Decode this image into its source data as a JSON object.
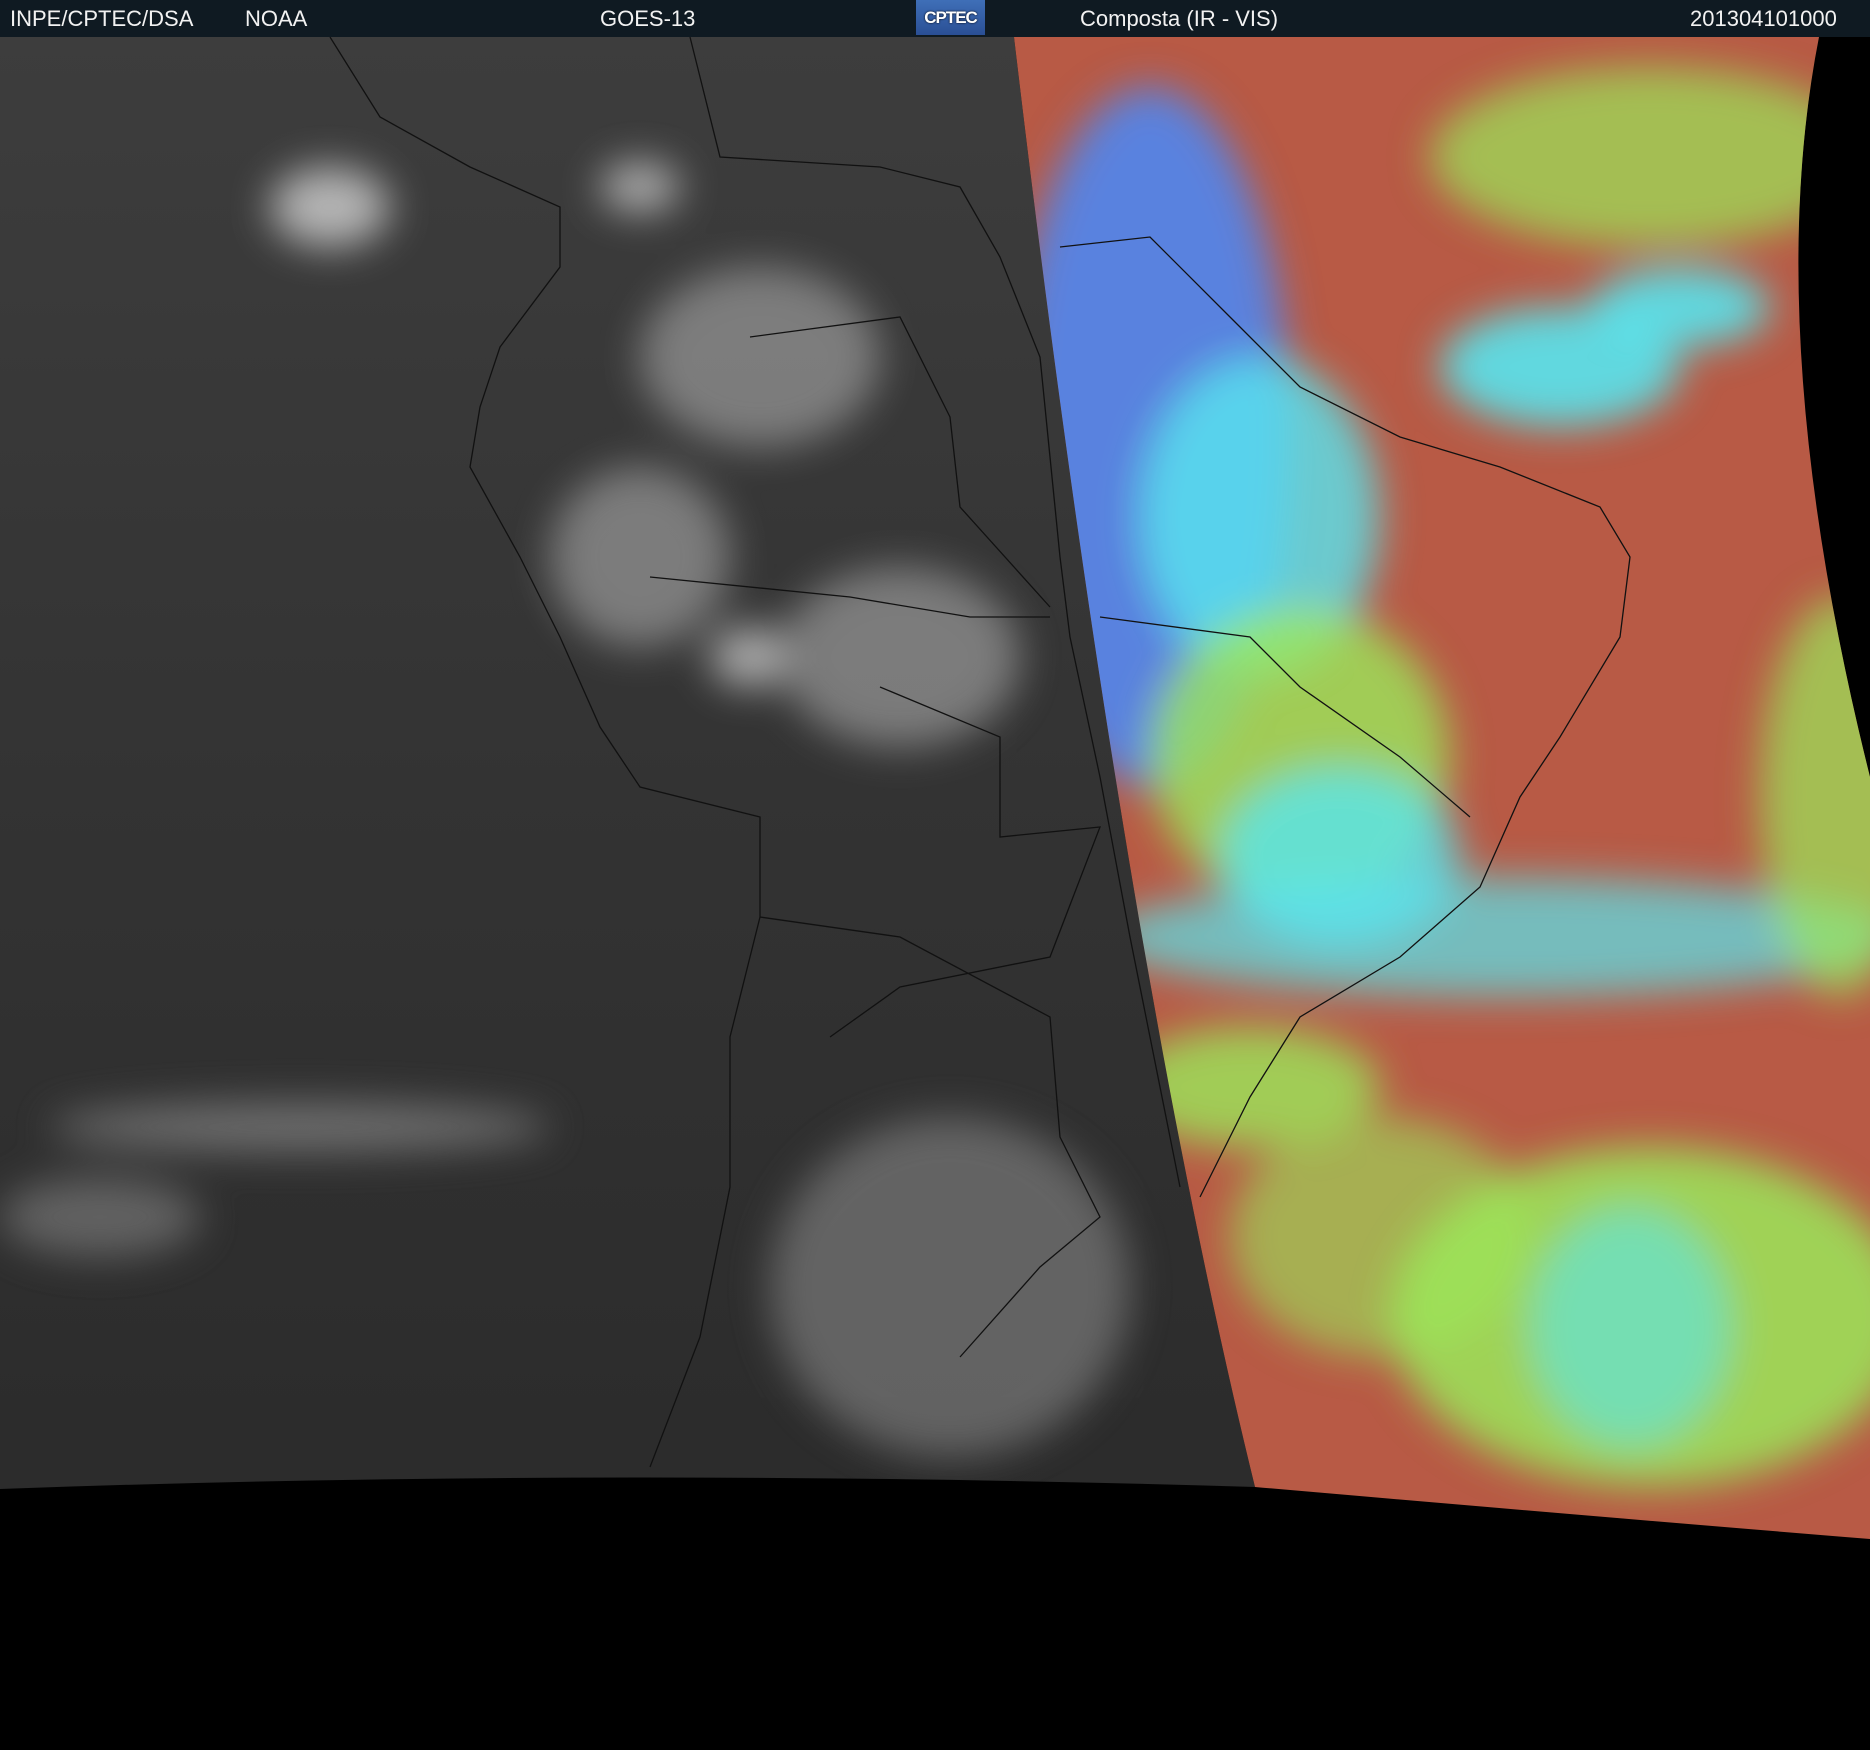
{
  "header": {
    "agency": "INPE/CPTEC/DSA",
    "partner": "NOAA",
    "satellite": "GOES-13",
    "logo_text": "CPTEC",
    "product": "Composta (IR - VIS)",
    "timestamp": "201304101000"
  },
  "colors": {
    "header_bg": "#0f1a22",
    "ir_gray": "#3a3a3a",
    "composite_red": "#b85a45",
    "composite_green": "#9be85a",
    "composite_cyan": "#58e6f0",
    "composite_blue": "#4f86f0"
  }
}
